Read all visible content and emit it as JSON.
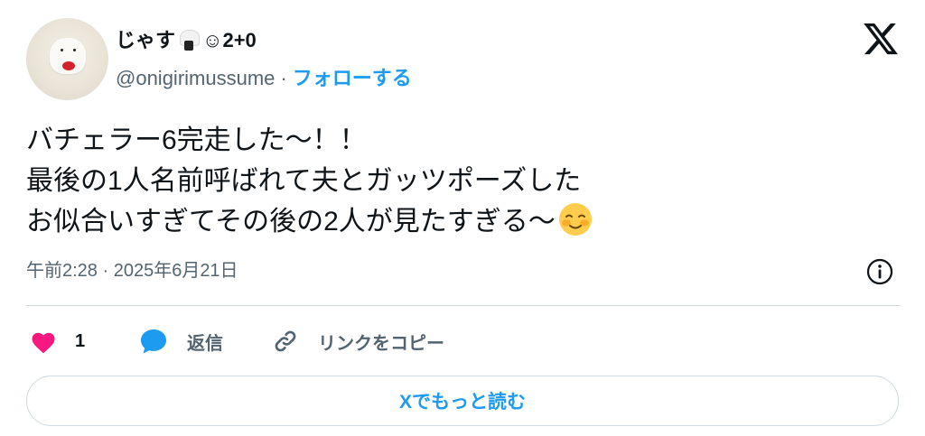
{
  "author": {
    "name_prefix": "じゃす",
    "name_suffix": "☺︎2+0",
    "handle": "@onigirimussume",
    "separator": "·",
    "follow_label": "フォローする"
  },
  "tweet": {
    "lines": [
      "バチェラー6完走した〜！！",
      "最後の1人名前呼ばれて夫とガッツポーズした",
      "お似合いすぎてその後の2人が見たすぎる〜"
    ],
    "timestamp": "午前2:28 · 2025年6月21日"
  },
  "actions": {
    "like_count": "1",
    "reply_label": "返信",
    "copy_link_label": "リンクをコピー"
  },
  "read_more_label": "Xでもっと読む",
  "colors": {
    "accent": "#1d9bf0",
    "like": "#f91880",
    "text": "#0f1419",
    "secondary": "#536471"
  },
  "icons": [
    "x-logo",
    "info-icon",
    "heart-icon",
    "reply-bubble-icon",
    "link-icon",
    "onigiri-emoji-icon",
    "smiling-face-emoji"
  ]
}
